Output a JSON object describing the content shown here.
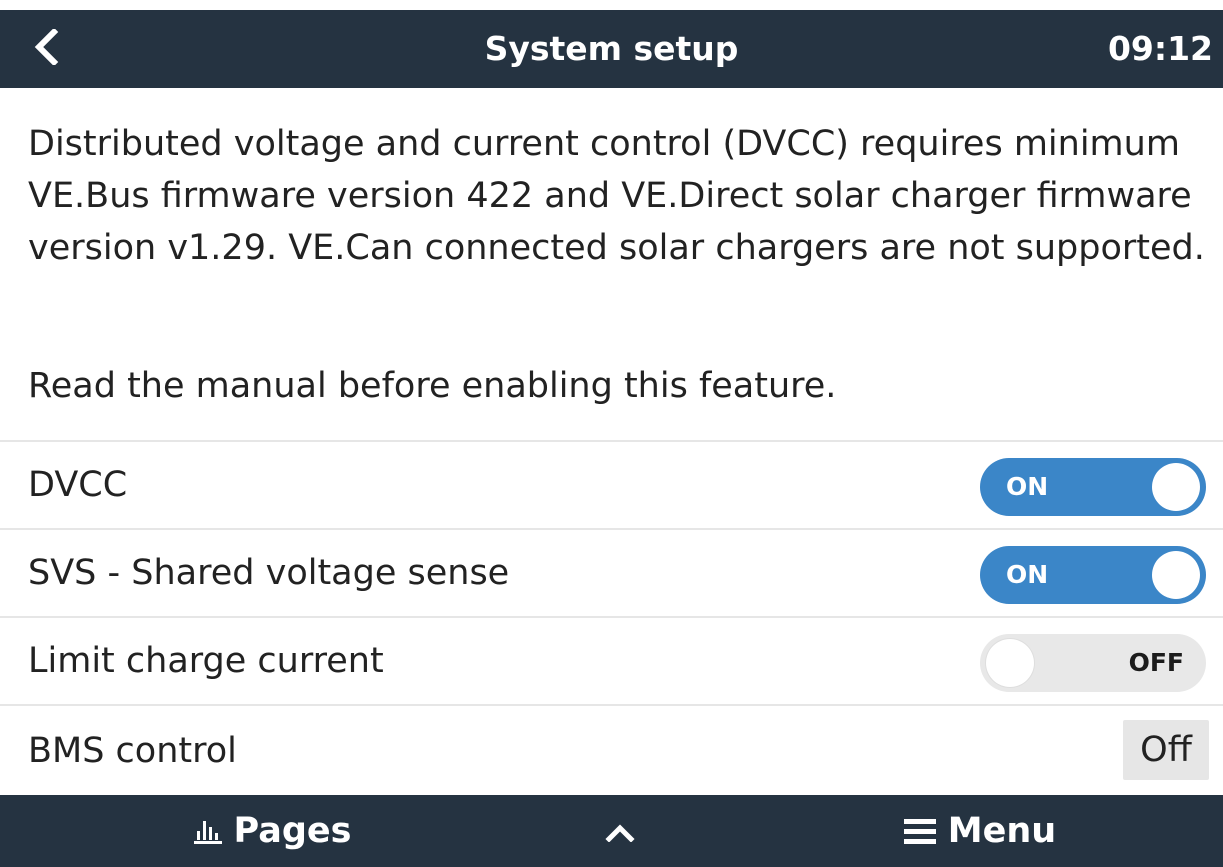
{
  "header": {
    "title": "System setup",
    "time": "09:12"
  },
  "description": {
    "paragraph_1": "Distributed voltage and current control (DVCC) requires minimum VE.Bus firmware version 422 and VE.Direct solar charger firmware version v1.29. VE.Can connected solar chargers are not supported.",
    "paragraph_2": "Read the manual before enabling this feature."
  },
  "settings": [
    {
      "label": "DVCC",
      "control": "switch",
      "state": "ON"
    },
    {
      "label": "SVS - Shared voltage sense",
      "control": "switch",
      "state": "ON"
    },
    {
      "label": "Limit charge current",
      "control": "switch",
      "state": "OFF"
    },
    {
      "label": "BMS control",
      "control": "value",
      "value": "Off"
    }
  ],
  "footer": {
    "pages_label": "Pages",
    "menu_label": "Menu"
  },
  "colors": {
    "bar_background": "#253341",
    "switch_on": "#3b86c8",
    "switch_off": "#e8e8e8"
  },
  "icons": {
    "back": "chevron-left-icon",
    "pages": "bar-chart-icon",
    "up": "chevron-up-icon",
    "menu": "hamburger-menu-icon"
  }
}
